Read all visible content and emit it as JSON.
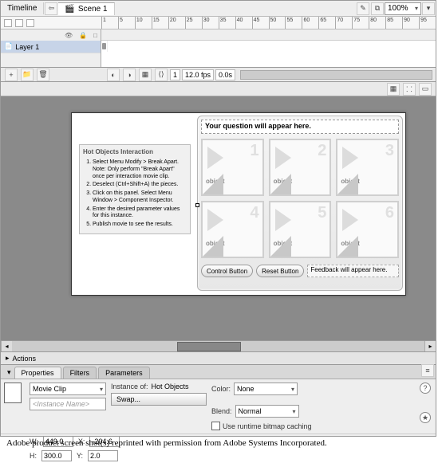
{
  "tabs": {
    "timeline": "Timeline",
    "scene": "Scene 1"
  },
  "zoom": "100%",
  "ruler_ticks": [
    "1",
    "5",
    "10",
    "15",
    "20",
    "25",
    "30",
    "35",
    "40",
    "45",
    "50",
    "55",
    "60",
    "65",
    "70",
    "75",
    "80",
    "85",
    "90",
    "95"
  ],
  "layer": {
    "name": "Layer 1"
  },
  "timeline_status": {
    "frame": "1",
    "fps": "12.0 fps",
    "time": "0.0s"
  },
  "instructions": {
    "title": "Hot Objects Interaction",
    "steps": [
      "Select Menu Modify > Break Apart. Note: Only perform \"Break Apart\" once per interaction movie clip.",
      "Deselect (Ctrl+Shift+A) the pieces.",
      "Click on this panel. Select Menu Window > Component Inspector.",
      "Enter the desired parameter values for this instance.",
      "Publish movie to see the results."
    ]
  },
  "quiz": {
    "question": "Your question will appear here.",
    "cells": [
      {
        "num": "1",
        "label": "object"
      },
      {
        "num": "2",
        "label": "object"
      },
      {
        "num": "3",
        "label": "object"
      },
      {
        "num": "4",
        "label": "object"
      },
      {
        "num": "5",
        "label": "object"
      },
      {
        "num": "6",
        "label": "object"
      }
    ],
    "control_btn": "Control Button",
    "reset_btn": "Reset Button",
    "feedback": "Feedback will appear here."
  },
  "actions_label": "Actions",
  "prop_tabs": {
    "properties": "Properties",
    "filters": "Filters",
    "parameters": "Parameters"
  },
  "props": {
    "type": "Movie Clip",
    "instance_placeholder": "<Instance Name>",
    "instance_of_label": "Instance of:",
    "instance_of_value": "Hot Objects",
    "swap": "Swap...",
    "color_label": "Color:",
    "color_value": "None",
    "blend_label": "Blend:",
    "blend_value": "Normal",
    "bitmap_cache": "Use runtime bitmap caching",
    "w_label": "W:",
    "w": "449.0",
    "h_label": "H:",
    "h": "300.0",
    "x_label": "X:",
    "x": "-204.6",
    "y_label": "Y:",
    "y": "2.0"
  },
  "caption": "Adobe product screen shot(s) reprinted with permission from Adobe Systems Incorporated."
}
